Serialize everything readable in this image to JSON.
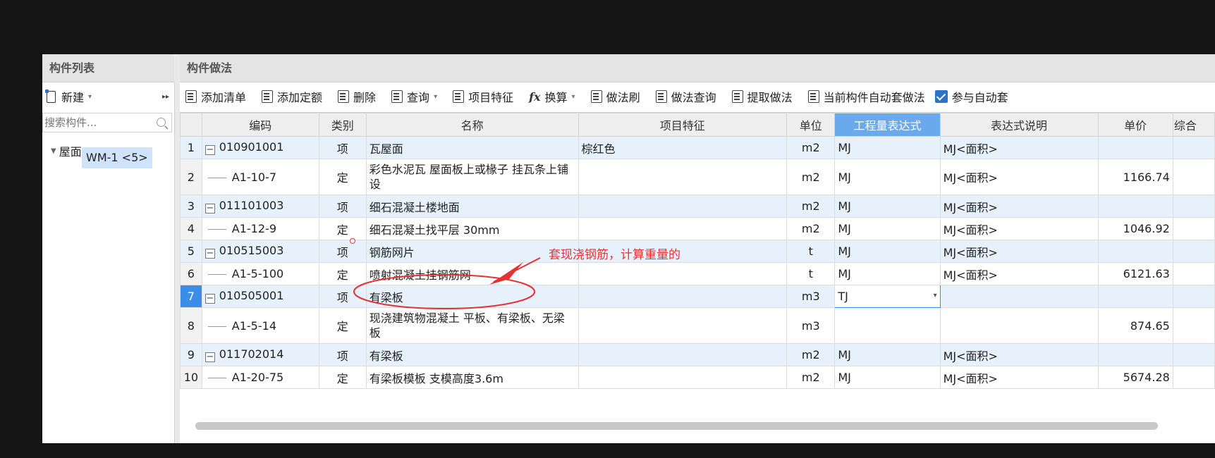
{
  "left_panel": {
    "title": "构件列表",
    "new_label": "新建",
    "search_placeholder": "搜索构件...",
    "tree": {
      "group_label": "屋面",
      "item_label": "WM-1 <5>"
    }
  },
  "right_panel": {
    "title": "构件做法",
    "toolbar": {
      "add_list": "添加清单",
      "add_quota": "添加定额",
      "delete": "删除",
      "query": "查询",
      "item_features": "项目特征",
      "convert": "换算",
      "method_brush": "做法刷",
      "method_query": "做法查询",
      "extract_method": "提取做法",
      "auto_apply": "当前构件自动套做法",
      "participate_auto": "参与自动套"
    },
    "columns": [
      "编码",
      "类别",
      "名称",
      "项目特征",
      "单位",
      "工程量表达式",
      "表达式说明",
      "单价",
      "综合"
    ],
    "rows": [
      {
        "num": "1",
        "code": "010901001",
        "type": "项",
        "name": "瓦屋面",
        "feature": "棕红色",
        "unit": "m2",
        "expr": "MJ",
        "desc": "MJ<面积>",
        "price": ""
      },
      {
        "num": "2",
        "code": "A1-10-7",
        "type": "定",
        "name": "彩色水泥瓦 屋面板上或椽子 挂瓦条上铺设",
        "feature": "",
        "unit": "m2",
        "expr": "MJ",
        "desc": "MJ<面积>",
        "price": "1166.74"
      },
      {
        "num": "3",
        "code": "011101003",
        "type": "项",
        "name": "细石混凝土楼地面",
        "feature": "",
        "unit": "m2",
        "expr": "MJ",
        "desc": "MJ<面积>",
        "price": ""
      },
      {
        "num": "4",
        "code": "A1-12-9",
        "type": "定",
        "name": "细石混凝土找平层 30mm",
        "feature": "",
        "unit": "m2",
        "expr": "MJ",
        "desc": "MJ<面积>",
        "price": "1046.92"
      },
      {
        "num": "5",
        "code": "010515003",
        "type": "项",
        "name": "钢筋网片",
        "feature": "",
        "unit": "t",
        "expr": "MJ",
        "desc": "MJ<面积>",
        "price": ""
      },
      {
        "num": "6",
        "code": "A1-5-100",
        "type": "定",
        "name": "喷射混凝土挂钢筋网",
        "feature": "",
        "unit": "t",
        "expr": "MJ",
        "desc": "MJ<面积>",
        "price": "6121.63"
      },
      {
        "num": "7",
        "code": "010505001",
        "type": "项",
        "name": "有梁板",
        "feature": "",
        "unit": "m3",
        "expr": "TJ",
        "desc": "",
        "price": ""
      },
      {
        "num": "8",
        "code": "A1-5-14",
        "type": "定",
        "name": "现浇建筑物混凝土 平板、有梁板、无梁板",
        "feature": "",
        "unit": "m3",
        "expr": "",
        "desc": "",
        "price": "874.65"
      },
      {
        "num": "9",
        "code": "011702014",
        "type": "项",
        "name": "有梁板",
        "feature": "",
        "unit": "m2",
        "expr": "MJ",
        "desc": "MJ<面积>",
        "price": ""
      },
      {
        "num": "10",
        "code": "A1-20-75",
        "type": "定",
        "name": "有梁板模板 支模高度3.6m",
        "feature": "",
        "unit": "m2",
        "expr": "MJ",
        "desc": "MJ<面积>",
        "price": "5674.28"
      }
    ]
  },
  "annotation": {
    "text": "套现浇钢筋，计算重量的",
    "color": "#e33333"
  },
  "colors": {
    "header_active": "#6aa9ec",
    "row_alt": "#e6f1fc",
    "accent": "#3b8ee8"
  }
}
